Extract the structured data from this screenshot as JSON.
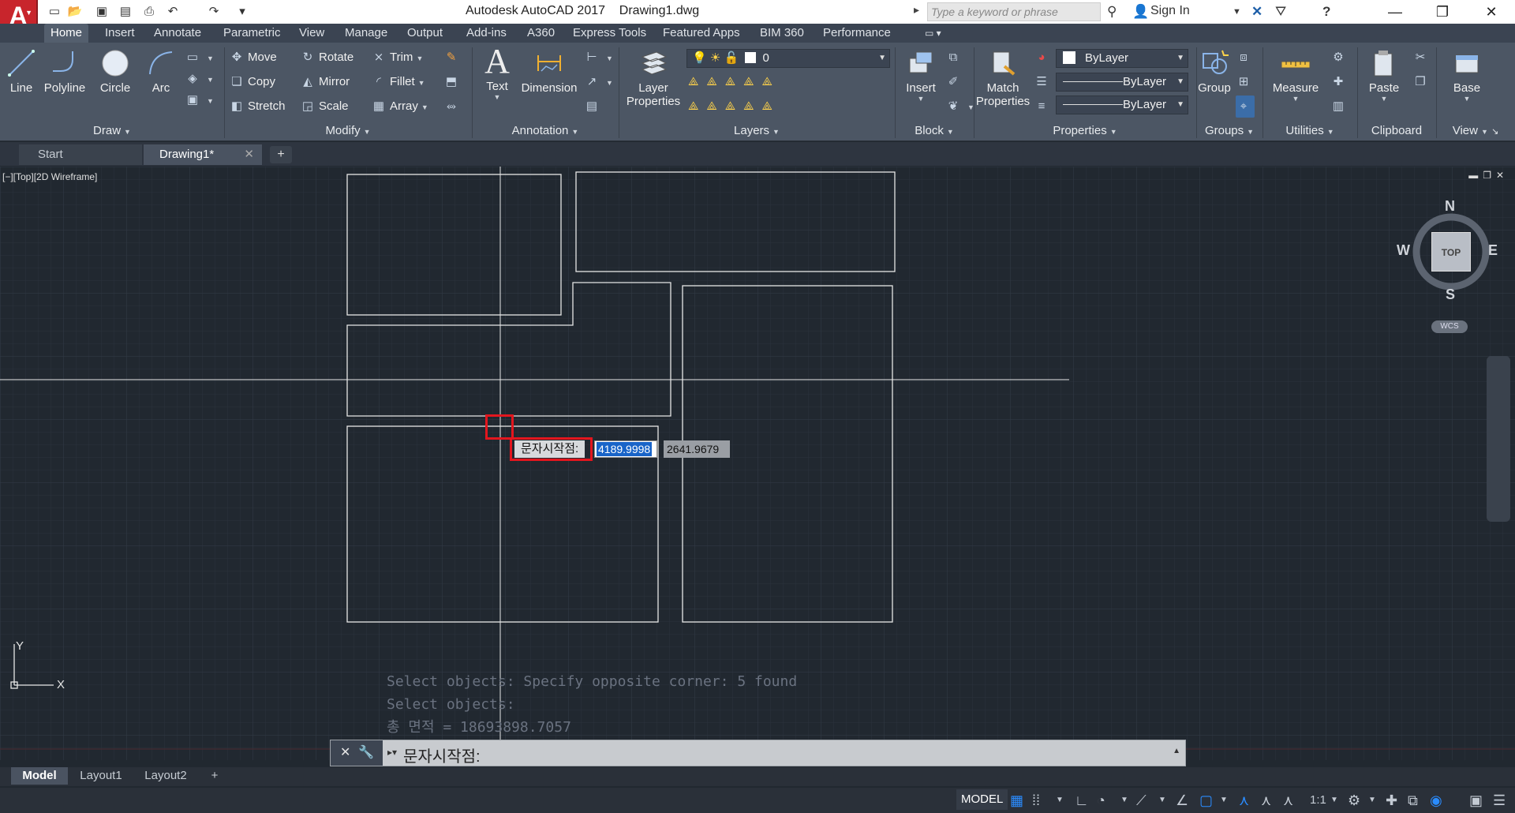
{
  "app": {
    "logo_letter": "A",
    "title": "Autodesk AutoCAD 2017    Drawing1.dwg",
    "search_placeholder": "Type a keyword or phrase",
    "sign_in": "Sign In"
  },
  "ribbon_tabs": [
    "Home",
    "Insert",
    "Annotate",
    "Parametric",
    "View",
    "Manage",
    "Output",
    "Add-ins",
    "A360",
    "Express Tools",
    "Featured Apps",
    "BIM 360",
    "Performance"
  ],
  "ribbon": {
    "draw": {
      "title": "Draw",
      "line": "Line",
      "polyline": "Polyline",
      "circle": "Circle",
      "arc": "Arc"
    },
    "modify": {
      "title": "Modify",
      "move": "Move",
      "rotate": "Rotate",
      "trim": "Trim",
      "copy": "Copy",
      "mirror": "Mirror",
      "fillet": "Fillet",
      "stretch": "Stretch",
      "scale": "Scale",
      "array": "Array"
    },
    "annotation": {
      "title": "Annotation",
      "text": "Text",
      "dimension": "Dimension"
    },
    "layers": {
      "title": "Layers",
      "layer_properties_1": "Layer",
      "layer_properties_2": "Properties",
      "current_layer": "0"
    },
    "block": {
      "title": "Block",
      "insert": "Insert"
    },
    "properties": {
      "title": "Properties",
      "match_1": "Match",
      "match_2": "Properties",
      "color": "ByLayer",
      "linetype": "ByLayer",
      "lineweight": "ByLayer"
    },
    "groups": {
      "title": "Groups",
      "group": "Group"
    },
    "utilities": {
      "title": "Utilities",
      "measure": "Measure"
    },
    "clipboard": {
      "title": "Clipboard",
      "paste": "Paste"
    },
    "view": {
      "title": "View",
      "base": "Base"
    }
  },
  "file_tabs": [
    "Start",
    "Drawing1*"
  ],
  "viewport": {
    "label": "[−][Top][2D Wireframe]",
    "compass": {
      "n": "N",
      "s": "S",
      "e": "E",
      "w": "W",
      "top": "TOP",
      "wcs": "WCS"
    }
  },
  "dynamic_input": {
    "label": "문자시작점:",
    "x_value": "4189.9998",
    "y_value": "2641.9679"
  },
  "command_history": [
    "Select objects: Specify opposite corner: 5 found",
    "Select objects:",
    "총 면적 = 18693898.7057"
  ],
  "command_prompt": "문자시작점:",
  "ucs": {
    "x": "X",
    "y": "Y"
  },
  "layout_tabs": [
    "Model",
    "Layout1",
    "Layout2"
  ],
  "status": {
    "model": "MODEL",
    "scale": "1:1"
  }
}
